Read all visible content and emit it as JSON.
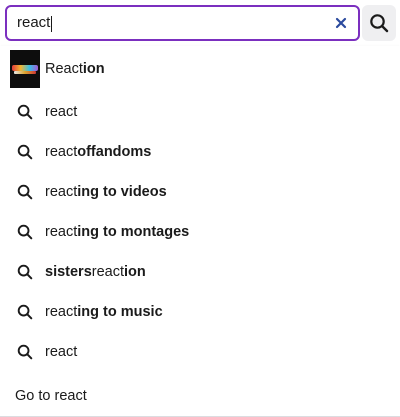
{
  "search": {
    "value": "react",
    "clear_icon": "close-icon",
    "submit_icon": "search-icon",
    "accent_color": "#7b2fbf"
  },
  "suggestions": {
    "channel": {
      "prefix": "React",
      "suffix": "ion",
      "thumbnail": "channel-thumbnail"
    },
    "items": [
      {
        "prefix": "react",
        "suffix": ""
      },
      {
        "prefix": "react",
        "suffix": "offandoms"
      },
      {
        "prefix": "react",
        "suffix": "ing to videos"
      },
      {
        "prefix": "react",
        "suffix": "ing to montages"
      },
      {
        "prefix": "sisters",
        "suffix": "reaction",
        "mixed": true
      },
      {
        "prefix": "react",
        "suffix": "ing to music"
      },
      {
        "prefix": "react",
        "suffix": ""
      }
    ],
    "goto_label": "Go to react"
  }
}
